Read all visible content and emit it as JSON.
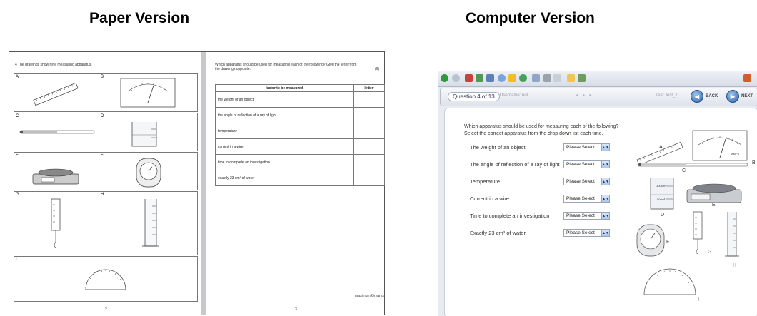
{
  "headings": {
    "paper": "Paper Version",
    "computer": "Computer Version"
  },
  "paper": {
    "intro": "4  The drawings show nine measuring apparatus.",
    "cells": [
      "A",
      "B",
      "C",
      "D",
      "E",
      "F",
      "G",
      "H",
      "I"
    ],
    "instruction": "Which apparatus should be used for measuring each of the following? Give the letter from the drawings opposite.",
    "marks": "(6)",
    "table_headers": [
      "factor to be measured",
      "letter"
    ],
    "table_rows": [
      "the weight of an object",
      "the angle of reflection of a ray of light",
      "temperature",
      "current in a wire",
      "time to complete an investigation",
      "exactly 23 cm³ of water"
    ],
    "total": "maximum 6 marks",
    "page_left": "2",
    "page_right": "3"
  },
  "computer": {
    "question_label": "Question 4 of 13",
    "username": "Username: null",
    "dots": "• • •",
    "test_name": "Test: test_1",
    "back_label": "BACK",
    "next_label": "NEXT",
    "instruction_line1": "Which apparatus should be used for measuring each of the following?",
    "instruction_line2": "Select the correct apparatus from the drop down list each time.",
    "questions": [
      "The weight of an object",
      "The angle of reflection of a ray of light",
      "Temperature",
      "Current in a wire",
      "Time to complete an investigation",
      "Exactly 23 cm³ of water"
    ],
    "select_placeholder": "Please Select",
    "apparatus_labels": [
      "A",
      "B",
      "C",
      "D",
      "E",
      "F",
      "G",
      "H",
      "I"
    ],
    "beaker_labels": [
      "100cm³",
      "50cm³"
    ],
    "meter_unit": "AMPS"
  }
}
